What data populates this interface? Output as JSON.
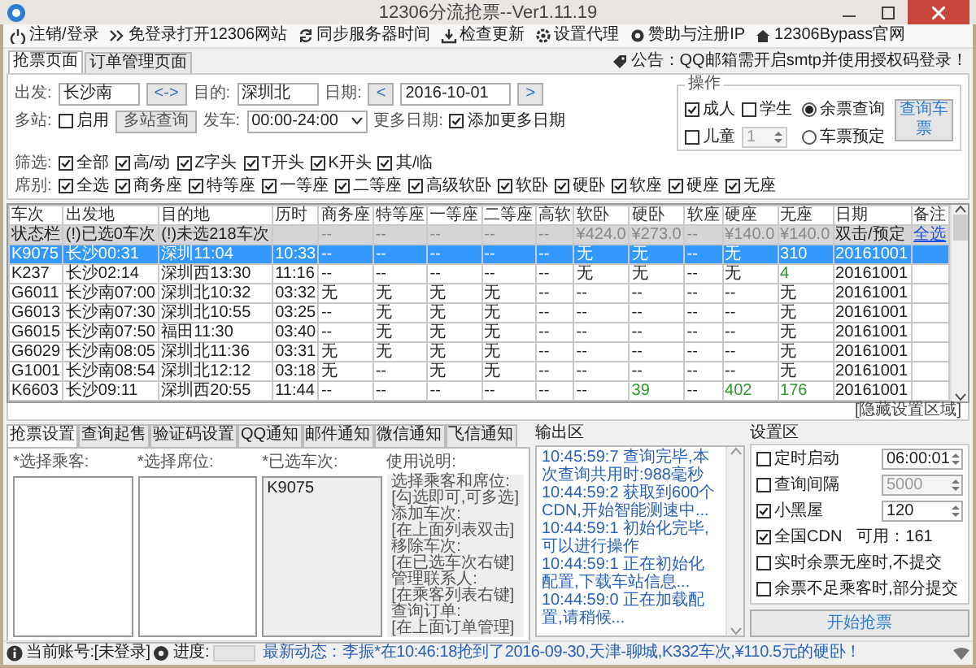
{
  "window": {
    "title": "12306分流抢票--Ver1.11.19"
  },
  "toolbar": [
    "注销/登录",
    "免登录打开12306网站",
    "同步服务器时间",
    "检查更新",
    "设置代理",
    "赞助与注册IP",
    "12306Bypass官网"
  ],
  "notice": "公告：QQ邮箱需开启smtp并使用授权码登录！",
  "tabs": [
    {
      "label": "抢票页面",
      "selected": true
    },
    {
      "label": "订单管理页面",
      "selected": false
    }
  ],
  "query": {
    "from": {
      "label": "出发:",
      "value": "长沙南"
    },
    "swap": "<->",
    "to": {
      "label": "目的:",
      "value": "深圳北"
    },
    "date": {
      "label": "日期:",
      "prev": "<",
      "value": "2016-10-01",
      "next": ">"
    },
    "multi": {
      "label": "多站:",
      "option": {
        "label": "启用",
        "checked": false
      },
      "button": "多站查询"
    },
    "depart": {
      "label": "发车:",
      "value": "00:00-24:00"
    },
    "more_dates": {
      "label": "更多日期:",
      "option": {
        "label": "添加更多日期",
        "checked": true
      }
    },
    "filter": {
      "label": "筛选:",
      "options": [
        {
          "label": "全部",
          "checked": true
        },
        {
          "label": "高/动",
          "checked": true
        },
        {
          "label": "Z字头",
          "checked": true
        },
        {
          "label": "T开头",
          "checked": true
        },
        {
          "label": "K开头",
          "checked": true
        },
        {
          "label": "其/临",
          "checked": true
        }
      ]
    },
    "seats": {
      "label": "席别:",
      "options": [
        {
          "label": "全选",
          "checked": true
        },
        {
          "label": "商务座",
          "checked": true
        },
        {
          "label": "特等座",
          "checked": true
        },
        {
          "label": "一等座",
          "checked": true
        },
        {
          "label": "二等座",
          "checked": true
        },
        {
          "label": "高级软卧",
          "checked": true
        },
        {
          "label": "软卧",
          "checked": true
        },
        {
          "label": "硬卧",
          "checked": true
        },
        {
          "label": "软座",
          "checked": true
        },
        {
          "label": "硬座",
          "checked": true
        },
        {
          "label": "无座",
          "checked": true
        }
      ]
    },
    "operation": {
      "title": "操作",
      "passengers": [
        {
          "label": "成人",
          "checked": true
        },
        {
          "label": "学生",
          "checked": false
        },
        {
          "label": "儿童",
          "checked": false
        }
      ],
      "child_count": {
        "value": "1",
        "disabled": true
      },
      "modes": [
        {
          "label": "余票查询",
          "selected": true
        },
        {
          "label": "车票预定",
          "selected": false
        }
      ],
      "button": "查询车票"
    }
  },
  "table": {
    "columns": [
      "车次",
      "出发地",
      "目的地",
      "历时",
      "商务座",
      "特等座",
      "一等座",
      "二等座",
      "高软",
      "软卧",
      "硬卧",
      "软座",
      "硬座",
      "无座",
      "日期",
      "备注"
    ],
    "status_row": {
      "label": "状态栏",
      "selected_count": "(!)已选0车次",
      "unselected_count": "(!)未选218车次",
      "prices": [
        "--",
        "--",
        "--",
        "--",
        "--",
        "¥424.0",
        "¥273.0",
        "--",
        "¥140.0",
        "¥140.0"
      ],
      "action": "双击/预定",
      "link": "全选"
    },
    "rows": [
      {
        "selected": true,
        "cells": [
          "K9075",
          "长沙00:31",
          "深圳11:04",
          "10:33",
          "--",
          "--",
          "--",
          "--",
          "--",
          "无",
          "无",
          "--",
          "无",
          "310",
          "20161001"
        ]
      },
      {
        "selected": false,
        "cells": [
          "K237",
          "长沙02:14",
          "深圳西13:30",
          "11:16",
          "--",
          "--",
          "--",
          "--",
          "--",
          "无",
          "无",
          "--",
          "无",
          {
            "text": "4",
            "available": true
          },
          "20161001"
        ]
      },
      {
        "selected": false,
        "cells": [
          "G6011",
          "长沙南07:00",
          "深圳北10:32",
          "03:32",
          "无",
          "无",
          "无",
          "无",
          "--",
          "--",
          "--",
          "--",
          "--",
          "无",
          "20161001"
        ]
      },
      {
        "selected": false,
        "cells": [
          "G6013",
          "长沙南07:30",
          "深圳北10:55",
          "03:25",
          "--",
          "无",
          "无",
          "无",
          "--",
          "--",
          "--",
          "--",
          "--",
          "无",
          "20161001"
        ]
      },
      {
        "selected": false,
        "cells": [
          "G6015",
          "长沙南07:50",
          "福田11:30",
          "03:40",
          "--",
          "无",
          "无",
          "无",
          "--",
          "--",
          "--",
          "--",
          "--",
          "无",
          "20161001"
        ]
      },
      {
        "selected": false,
        "cells": [
          "G6029",
          "长沙南08:05",
          "深圳北11:36",
          "03:31",
          "无",
          "无",
          "无",
          "无",
          "--",
          "--",
          "--",
          "--",
          "--",
          "无",
          "20161001"
        ]
      },
      {
        "selected": false,
        "cells": [
          "G1001",
          "长沙南08:54",
          "深圳北12:12",
          "03:18",
          "无",
          "--",
          "无",
          "无",
          "--",
          "--",
          "--",
          "--",
          "--",
          "无",
          "20161001"
        ]
      },
      {
        "selected": false,
        "cells": [
          "K6603",
          "长沙09:11",
          "深圳西20:55",
          "11:44",
          "--",
          "--",
          "--",
          "--",
          "--",
          "--",
          {
            "text": "39",
            "available": true
          },
          "--",
          {
            "text": "402",
            "available": true
          },
          {
            "text": "176",
            "available": true
          },
          "20161001"
        ]
      }
    ]
  },
  "hide_link": "[隐藏设置区域]",
  "settings_tabs": [
    {
      "label": "抢票设置",
      "selected": true
    },
    {
      "label": "查询起售",
      "selected": false
    },
    {
      "label": "验证码设置",
      "selected": false
    },
    {
      "label": "QQ通知",
      "selected": false
    },
    {
      "label": "邮件通知",
      "selected": false
    },
    {
      "label": "微信通知",
      "selected": false
    },
    {
      "label": "飞信通知",
      "selected": false
    }
  ],
  "passengers_label": "*选择乘客:",
  "seat_label": "*选择席位:",
  "selected_trains": {
    "label": "*已选车次:",
    "items": [
      "K9075"
    ]
  },
  "help": {
    "title": "使用说明:",
    "lines": [
      "选择乘客和席位:",
      "[勾选即可,可多选]",
      "添加车次:",
      "[在上面列表双击]",
      "移除车次:",
      "[在已选车次右键]",
      "管理联系人:",
      "[在乘客列表右键]",
      "查询订单:",
      "[在上面订单管理]"
    ]
  },
  "output": {
    "title": "输出区",
    "lines": [
      {
        "time": "10:45:59:7",
        "text": "查询完毕,本次查询共用时:988毫秒"
      },
      {
        "time": "10:44:59:2",
        "text": "获取到600个CDN,开始智能测速中..."
      },
      {
        "time": "10:44:59:1",
        "text": "初始化完毕,可以进行操作"
      },
      {
        "time": "10:44:59:1",
        "text": "正在初始化配置,下载车站信息..."
      },
      {
        "time": "10:44:59:0",
        "text": "正在加载配置,请稍候..."
      }
    ]
  },
  "settings": {
    "title": "设置区",
    "items": [
      {
        "kind": "input",
        "label": "定时启动",
        "checked": false,
        "value": "06:00:01",
        "disabled": false
      },
      {
        "kind": "input",
        "label": "查询间隔",
        "checked": false,
        "value": "5000",
        "disabled": true
      },
      {
        "kind": "input",
        "label": "小黑屋",
        "checked": true,
        "value": "120",
        "disabled": false
      },
      {
        "kind": "note",
        "label": "全国CDN",
        "checked": true,
        "note": "可用：161"
      },
      {
        "kind": "plain",
        "label": "实时余票无座时,不提交",
        "checked": false
      },
      {
        "kind": "plain",
        "label": "余票不足乘客时,部分提交",
        "checked": false
      }
    ],
    "button": "开始抢票"
  },
  "status_bar": {
    "account": "当前账号:[未登录]",
    "progress": {
      "label": "进度:",
      "level": 0
    },
    "news": "最新动态：李振*在10:46:18抢到了2016-09-30,天津-聊城,K332车次,¥110.5元的硬卧！"
  }
}
